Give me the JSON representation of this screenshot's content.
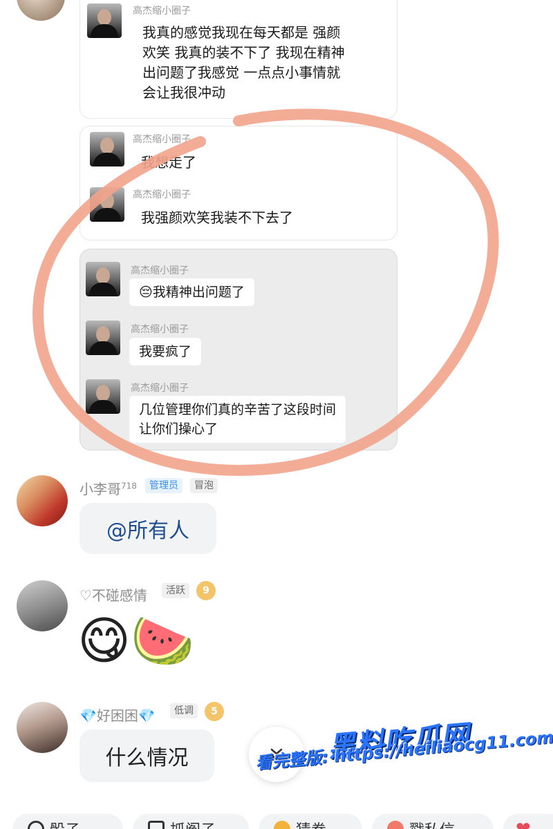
{
  "forwarded": {
    "card1": {
      "name": "高杰缩小圈子",
      "text_lines": [
        "我真的感觉我现在每天都是 强颜",
        "欢笑 我真的装不下了 我现在精神",
        "出问题了我感觉 一点点小事情就",
        "会让我很冲动"
      ]
    },
    "card2": {
      "messages": [
        {
          "name": "高杰缩小圈子",
          "text": "我想走了"
        },
        {
          "name": "高杰缩小圈子",
          "text": "我强颜欢笑我装不下去了"
        }
      ]
    },
    "card3": {
      "messages": [
        {
          "name": "高杰缩小圈子",
          "text": "我精神出问题了",
          "emoji": "😔"
        },
        {
          "name": "高杰缩小圈子",
          "text": "我要疯了"
        },
        {
          "name": "高杰缩小圈子",
          "text_lines": [
            "几位管理你们真的辛苦了这段时间",
            "让你们操心了"
          ]
        }
      ]
    }
  },
  "chat": [
    {
      "name": "小李哥",
      "name_sup": "718",
      "tags": [
        {
          "label": "管理员",
          "color": "#3a8ee6",
          "bg": "#e8f2fd"
        },
        {
          "label": "冒泡",
          "color": "#666666",
          "bg": "#f0f0f0"
        }
      ],
      "message": "@所有人",
      "message_color": "#1f4f8f"
    },
    {
      "name": "♡不碰感情",
      "tags": [
        {
          "label": "活跃",
          "color": "#666666",
          "bg": "#f0f0f0"
        }
      ],
      "level_badge": "9",
      "sticker": "😋🍉"
    },
    {
      "name": "💎好困困💎",
      "tags": [
        {
          "label": "低调",
          "color": "#666666",
          "bg": "#f0f0f0"
        }
      ],
      "level_badge": "5",
      "message": "什么情况"
    }
  ],
  "scroll_button_icon": "double-chevron-down-icon",
  "watermark": {
    "logo": "黑料吃瓜网",
    "url": "看完整版: https://heiliaocg11.com"
  },
  "quick_bar": [
    {
      "label": "骰子"
    },
    {
      "label": "抓阄子"
    },
    {
      "label": "猜拳"
    },
    {
      "label": "戳私信"
    }
  ],
  "colors": {
    "annotation": "#f2a48c",
    "watermark": "#2a74ff"
  }
}
